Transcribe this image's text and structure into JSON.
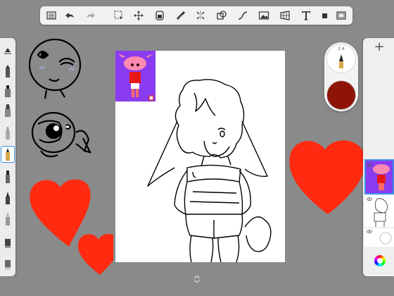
{
  "toolbar": {
    "icons": [
      "list-icon",
      "undo-icon",
      "redo-icon",
      "selection-icon",
      "transform-icon",
      "fill-icon",
      "ruler-icon",
      "symmetry-icon",
      "shapes-icon",
      "curve-icon",
      "image-icon",
      "perspective-icon",
      "text-icon",
      "layer-icon",
      "fullscreen-icon"
    ]
  },
  "brush_size_label": "2.4",
  "colors": {
    "current_color": "#8e1506",
    "heart_red": "#ff2a10",
    "selection_blue": "#3a8ee6"
  }
}
